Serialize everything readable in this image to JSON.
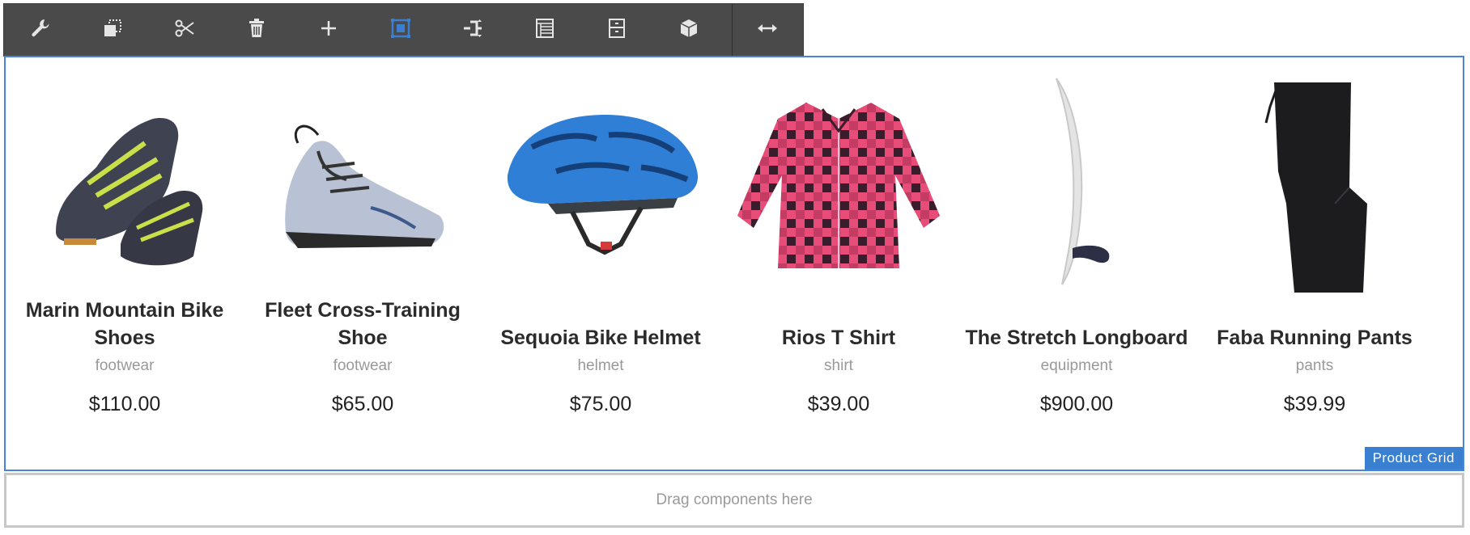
{
  "toolbar": {
    "buttons": [
      {
        "name": "configure",
        "icon": "wrench-icon"
      },
      {
        "name": "copy",
        "icon": "copy-icon"
      },
      {
        "name": "cut",
        "icon": "scissors-icon"
      },
      {
        "name": "delete",
        "icon": "trash-icon"
      },
      {
        "name": "insert",
        "icon": "plus-icon"
      },
      {
        "name": "select-parent",
        "icon": "select-parent-icon"
      },
      {
        "name": "group",
        "icon": "group-icon"
      },
      {
        "name": "layout",
        "icon": "layout-icon"
      },
      {
        "name": "convert",
        "icon": "cabinet-icon"
      },
      {
        "name": "assets",
        "icon": "boxes-icon"
      },
      {
        "name": "resize",
        "icon": "resize-arrows-icon"
      }
    ],
    "accent": "#3b7fd1"
  },
  "component": {
    "label": "Product Grid",
    "frame_color": "#4a86cf"
  },
  "products": [
    {
      "name": "Marin Mountain Bike Shoes",
      "category": "footwear",
      "price": "$110.00"
    },
    {
      "name": "Fleet Cross-Training Shoe",
      "category": "footwear",
      "price": "$65.00"
    },
    {
      "name": "Sequoia Bike Helmet",
      "category": "helmet",
      "price": "$75.00"
    },
    {
      "name": "Rios T Shirt",
      "category": "shirt",
      "price": "$39.00"
    },
    {
      "name": "The Stretch Longboard",
      "category": "equipment",
      "price": "$900.00"
    },
    {
      "name": "Faba Running Pants",
      "category": "pants",
      "price": "$39.99"
    }
  ],
  "dropzone": {
    "label": "Drag components here"
  }
}
